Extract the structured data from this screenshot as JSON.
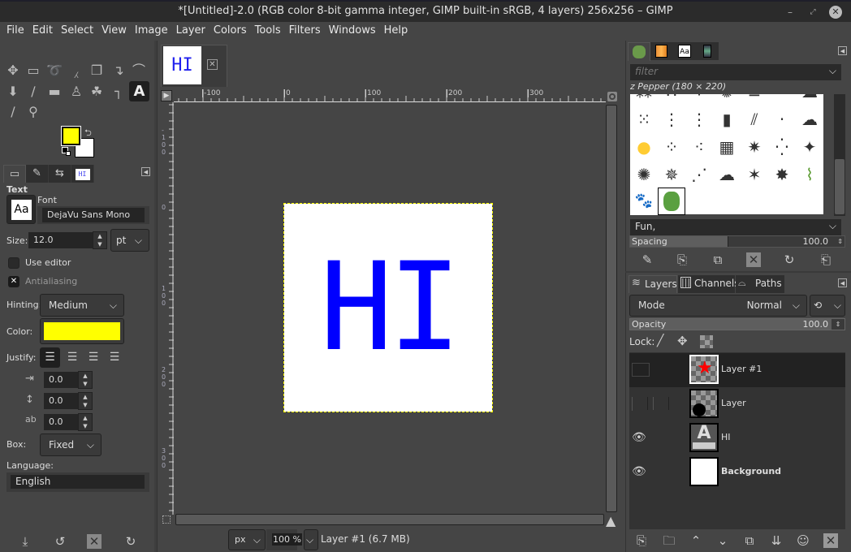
{
  "window": {
    "title": "*[Untitled]-2.0 (RGB color 8-bit gamma integer, GIMP built-in sRGB, 4 layers) 256x256 – GIMP",
    "minimize_icon": "minimize-icon",
    "maximize_icon": "maximize-icon",
    "close_icon": "close-icon"
  },
  "menubar": [
    "File",
    "Edit",
    "Select",
    "View",
    "Image",
    "Layer",
    "Colors",
    "Tools",
    "Filters",
    "Windows",
    "Help"
  ],
  "toolbox": {
    "tools": [
      {
        "name": "move-tool",
        "glyph": "✥"
      },
      {
        "name": "rect-select-tool",
        "glyph": "▭"
      },
      {
        "name": "free-select-tool",
        "glyph": "➰"
      },
      {
        "name": "fuzzy-select-tool",
        "glyph": "⁁"
      },
      {
        "name": "crop-tool",
        "glyph": "❐"
      },
      {
        "name": "transform-tool",
        "glyph": "↴"
      },
      {
        "name": "warp-tool",
        "glyph": "⌒"
      },
      {
        "name": "bucket-fill-tool",
        "glyph": "⬇"
      },
      {
        "name": "paintbrush-tool",
        "glyph": "∕"
      },
      {
        "name": "eraser-tool",
        "glyph": "▬"
      },
      {
        "name": "clone-tool",
        "glyph": "♙"
      },
      {
        "name": "smudge-tool",
        "glyph": "☘"
      },
      {
        "name": "paths-tool",
        "glyph": "┐"
      },
      {
        "name": "text-tool",
        "glyph": "A"
      },
      {
        "name": "color-picker-tool",
        "glyph": "∕"
      },
      {
        "name": "zoom-tool",
        "glyph": "⚲"
      }
    ],
    "fg_color": "#ffff00",
    "bg_color": "#ffffff",
    "tabs": [
      "tool-options",
      "device-status",
      "undo-history",
      "images"
    ],
    "images_tab_label": "HI"
  },
  "text_options": {
    "heading": "Text",
    "font_label": "Font",
    "font_preview": "Aa",
    "font_value": "DejaVu Sans Mono",
    "size_label": "Size:",
    "size_value": "12.0",
    "size_unit": "pt",
    "use_editor_label": "Use editor",
    "use_editor_checked": false,
    "antialiasing_label": "Antialiasing",
    "antialiasing_checked": true,
    "hinting_label": "Hinting:",
    "hinting_value": "Medium",
    "color_label": "Color:",
    "color_value": "#ffff00",
    "justify_label": "Justify:",
    "justify_options": [
      "left",
      "right",
      "center",
      "fill"
    ],
    "justify_selected": "left",
    "indent_value": "0.0",
    "line_spacing_value": "0.0",
    "letter_spacing_value": "0.0",
    "box_label": "Box:",
    "box_value": "Fixed",
    "language_label": "Language:",
    "language_value": "English",
    "bottom_buttons": [
      "save-options",
      "restore-options",
      "delete-options",
      "reset-options"
    ]
  },
  "image_window": {
    "thumb_text": "HI",
    "hruler_labels": [
      "-100",
      "0",
      "100",
      "200",
      "300"
    ],
    "vruler_labels": [
      "-100",
      "0",
      "100",
      "200",
      "300"
    ],
    "canvas_text": "HI",
    "canvas_text_color": "#0000ff",
    "unit": "px",
    "zoom": "100 %",
    "status": "Layer #1 (6.7 MB)"
  },
  "brushes_panel": {
    "tabs": [
      "brushes",
      "gradients",
      "fonts",
      "patterns"
    ],
    "filter_placeholder": "filter",
    "selected_brush": "z Pepper (180 × 220)",
    "tag": "Fun,",
    "spacing_label": "Spacing",
    "spacing_value": "100.0",
    "buttons": [
      "edit-brush",
      "new-brush",
      "duplicate-brush",
      "delete-brush",
      "refresh-brushes",
      "open-brush-folder"
    ]
  },
  "layers_panel": {
    "tabs": [
      "Layers",
      "Channels",
      "Paths"
    ],
    "mode_label": "Mode",
    "mode_value": "Normal",
    "opacity_label": "Opacity",
    "opacity_value": "100.0",
    "lock_label": "Lock:",
    "layers": [
      {
        "name": "Layer #1",
        "visible": false,
        "selected": true,
        "bold": false,
        "thumb": "star"
      },
      {
        "name": "Layer",
        "visible": false,
        "selected": false,
        "bold": false,
        "thumb": "dot"
      },
      {
        "name": "HI",
        "visible": true,
        "selected": false,
        "bold": false,
        "thumb": "text"
      },
      {
        "name": "Background",
        "visible": true,
        "selected": false,
        "bold": true,
        "thumb": "white"
      }
    ],
    "buttons": [
      "new-layer",
      "new-layer-group",
      "raise-layer",
      "lower-layer",
      "duplicate-layer",
      "merge-layer",
      "layer-mask",
      "delete-layer"
    ]
  }
}
